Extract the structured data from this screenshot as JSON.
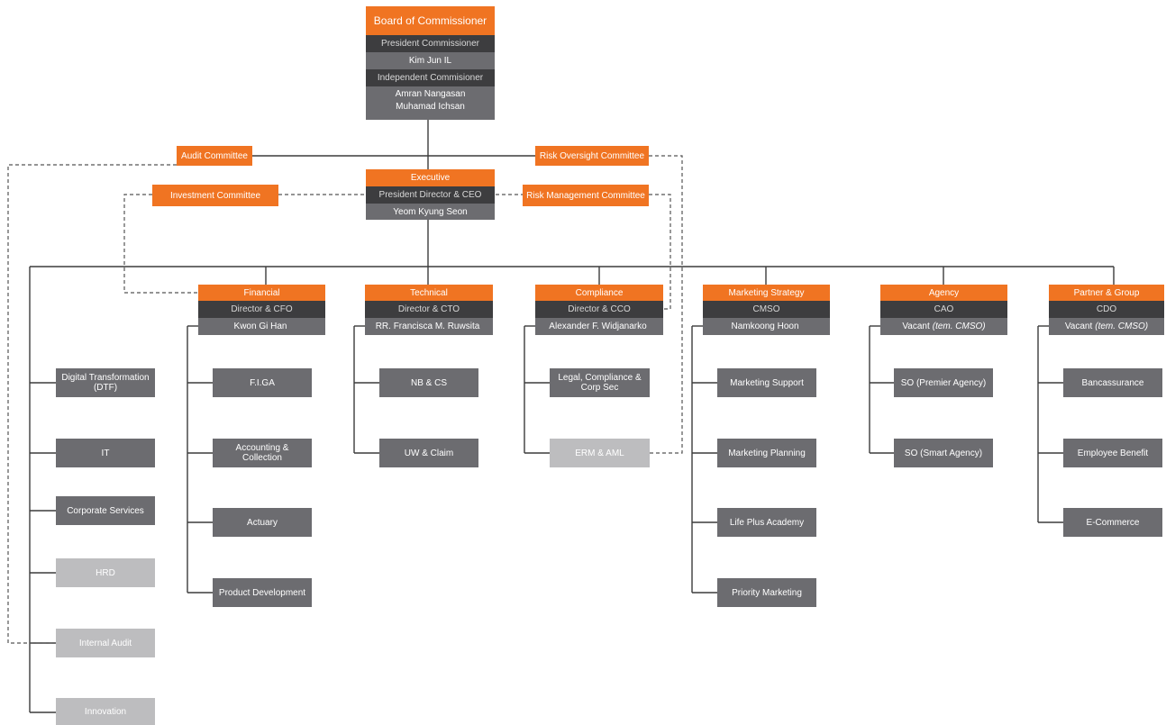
{
  "board": {
    "title": "Board of Commissioner",
    "president_role": "President Commissioner",
    "president_name": "Kim Jun IL",
    "independent_role": "Independent Commisioner",
    "independent_names": [
      "Amran Nangasan",
      "Muhamad Ichsan"
    ]
  },
  "committees": {
    "audit": "Audit Committee",
    "risk_oversight": "Risk Oversight Committee",
    "investment": "Investment Committee",
    "risk_management": "Risk Management Committee"
  },
  "executive": {
    "title": "Executive",
    "role": "President Director & CEO",
    "name": "Yeom Kyung Seon"
  },
  "units_left": [
    {
      "label": "Digital Transformation (DTF)",
      "tone": "dark"
    },
    {
      "label": "IT",
      "tone": "dark"
    },
    {
      "label": "Corporate Services",
      "tone": "dark"
    },
    {
      "label": "HRD",
      "tone": "light"
    },
    {
      "label": "Internal Audit",
      "tone": "light"
    },
    {
      "label": "Innovation",
      "tone": "light"
    }
  ],
  "directorates": [
    {
      "id": "financial",
      "title": "Financial",
      "role": "Director & CFO",
      "name": "Kwon Gi Han",
      "name_note": "",
      "units": [
        {
          "label": "F.I.GA",
          "tone": "dark"
        },
        {
          "label": "Accounting & Collection",
          "tone": "dark"
        },
        {
          "label": "Actuary",
          "tone": "dark"
        },
        {
          "label": "Product Development",
          "tone": "dark"
        }
      ]
    },
    {
      "id": "technical",
      "title": "Technical",
      "role": "Director & CTO",
      "name": "RR. Francisca M. Ruwsita",
      "name_note": "",
      "units": [
        {
          "label": "NB & CS",
          "tone": "dark"
        },
        {
          "label": "UW & Claim",
          "tone": "dark"
        }
      ]
    },
    {
      "id": "compliance",
      "title": "Compliance",
      "role": "Director & CCO",
      "name": "Alexander F. Widjanarko",
      "name_note": "",
      "units": [
        {
          "label": "Legal, Compliance & Corp Sec",
          "tone": "dark"
        },
        {
          "label": "ERM & AML",
          "tone": "light"
        }
      ]
    },
    {
      "id": "marketing",
      "title": "Marketing Strategy",
      "role": "CMSO",
      "name": "Namkoong Hoon",
      "name_note": "",
      "units": [
        {
          "label": "Marketing Support",
          "tone": "dark"
        },
        {
          "label": "Marketing Planning",
          "tone": "dark"
        },
        {
          "label": "Life Plus Academy",
          "tone": "dark"
        },
        {
          "label": "Priority Marketing",
          "tone": "dark"
        }
      ]
    },
    {
      "id": "agency",
      "title": "Agency",
      "role": "CAO",
      "name": "Vacant",
      "name_note": "(tem. CMSO)",
      "units": [
        {
          "label": "SO (Premier Agency)",
          "tone": "dark"
        },
        {
          "label": "SO (Smart Agency)",
          "tone": "dark"
        }
      ]
    },
    {
      "id": "partner",
      "title": "Partner & Group",
      "role": "CDO",
      "name": "Vacant",
      "name_note": "(tem. CMSO)",
      "units": [
        {
          "label": "Bancassurance",
          "tone": "dark"
        },
        {
          "label": "Employee Benefit",
          "tone": "dark"
        },
        {
          "label": "E-Commerce",
          "tone": "dark"
        }
      ]
    }
  ],
  "colors": {
    "orange": "#f07422",
    "dark_row": "#3d3d3f",
    "grey_row": "#6c6c70",
    "light_unit": "#bdbdbf",
    "line": "#3c3c3c"
  }
}
